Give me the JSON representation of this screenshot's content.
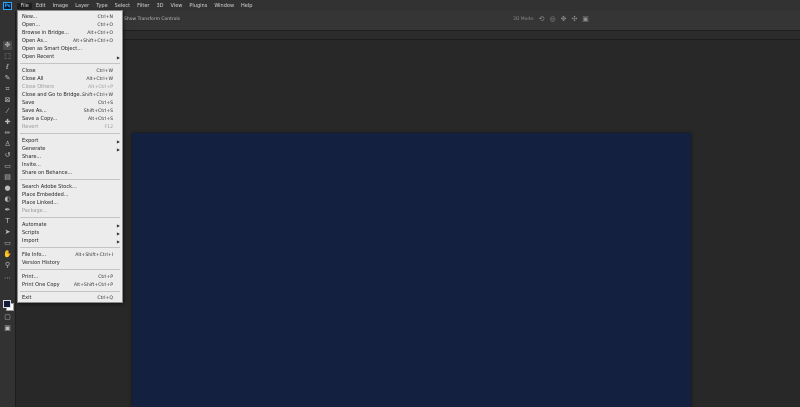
{
  "app": {
    "logo_text": "Ps"
  },
  "menubar": [
    "File",
    "Edit",
    "Image",
    "Layer",
    "Type",
    "Select",
    "Filter",
    "3D",
    "View",
    "Plugins",
    "Window",
    "Help"
  ],
  "options": {
    "transform_label": "Show Transform Controls",
    "mode_3d": "3D Mode:"
  },
  "file_menu": [
    {
      "label": "New...",
      "shortcut": "Ctrl+N"
    },
    {
      "label": "Open...",
      "shortcut": "Ctrl+O"
    },
    {
      "label": "Browse in Bridge...",
      "shortcut": "Alt+Ctrl+O"
    },
    {
      "label": "Open As...",
      "shortcut": "Alt+Shift+Ctrl+O"
    },
    {
      "label": "Open as Smart Object..."
    },
    {
      "label": "Open Recent",
      "submenu": true
    },
    {
      "label": "Close",
      "shortcut": "Ctrl+W"
    },
    {
      "label": "Close All",
      "shortcut": "Alt+Ctrl+W"
    },
    {
      "label": "Close Others",
      "shortcut": "Alt+Ctrl+P",
      "disabled": true
    },
    {
      "label": "Close and Go to Bridge...",
      "shortcut": "Shift+Ctrl+W"
    },
    {
      "label": "Save",
      "shortcut": "Ctrl+S"
    },
    {
      "label": "Save As...",
      "shortcut": "Shift+Ctrl+S"
    },
    {
      "label": "Save a Copy...",
      "shortcut": "Alt+Ctrl+S"
    },
    {
      "label": "Revert",
      "shortcut": "F12",
      "disabled": true
    },
    {
      "label": "Export",
      "submenu": true
    },
    {
      "label": "Generate",
      "submenu": true
    },
    {
      "label": "Share..."
    },
    {
      "label": "Invite..."
    },
    {
      "label": "Share on Behance..."
    },
    {
      "label": "Search Adobe Stock..."
    },
    {
      "label": "Place Embedded..."
    },
    {
      "label": "Place Linked..."
    },
    {
      "label": "Package...",
      "disabled": true
    },
    {
      "label": "Automate",
      "submenu": true
    },
    {
      "label": "Scripts",
      "submenu": true
    },
    {
      "label": "Import",
      "submenu": true
    },
    {
      "label": "File Info...",
      "shortcut": "Alt+Shift+Ctrl+I"
    },
    {
      "label": "Version History"
    },
    {
      "label": "Print...",
      "shortcut": "Ctrl+P"
    },
    {
      "label": "Print One Copy",
      "shortcut": "Alt+Shift+Ctrl+P"
    },
    {
      "label": "Exit",
      "shortcut": "Ctrl+Q"
    }
  ],
  "colors": {
    "canvas": "#14203f",
    "foreground": "#0f1c3c",
    "background": "#ffffff"
  }
}
